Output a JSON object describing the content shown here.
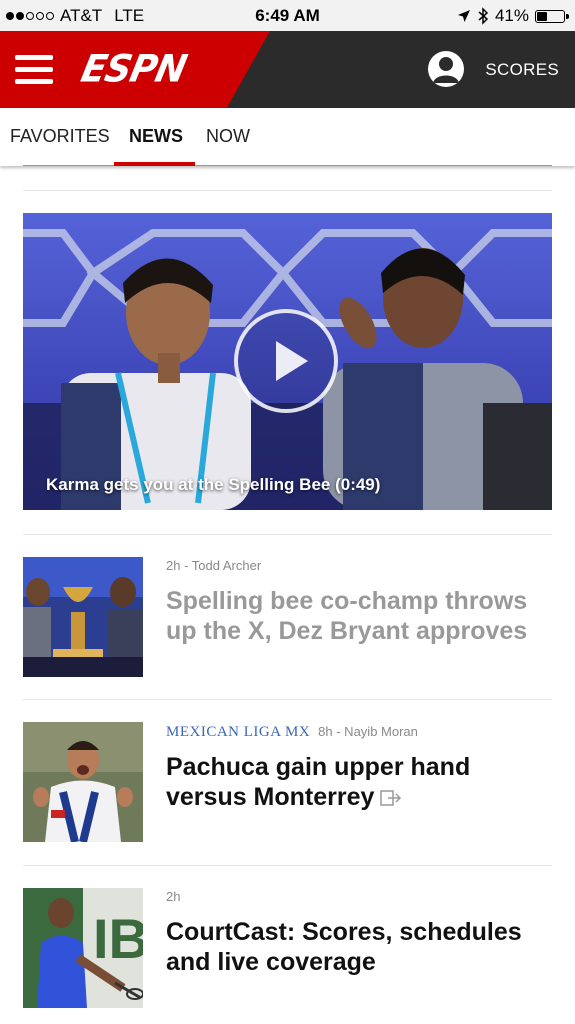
{
  "status_bar": {
    "carrier": "AT&T",
    "network": "LTE",
    "time": "6:49 AM",
    "battery": "41%",
    "battery_level": 0.41,
    "signal_bars": 2
  },
  "header": {
    "logo": "ESPN",
    "scores_label": "SCORES",
    "brand_color": "#cc0000"
  },
  "tabs": [
    {
      "label": "FAVORITES"
    },
    {
      "label": "NEWS"
    },
    {
      "label": "NOW"
    }
  ],
  "active_tab": "NEWS",
  "video": {
    "caption": "Karma gets you at the Spelling Bee (0:49)",
    "icon": "play-icon"
  },
  "articles": [
    {
      "category": "",
      "meta": "2h - Todd Archer",
      "headline": "Spelling bee co-champ throws up the X, Dez Bryant approves",
      "read": true
    },
    {
      "category": "MEXICAN LIGA MX",
      "meta": "8h - Nayib Moran",
      "headline": "Pachuca gain upper hand versus Monterrey",
      "external": true
    },
    {
      "category": "",
      "meta": "2h",
      "headline": "CourtCast: Scores, schedules and live coverage"
    }
  ]
}
